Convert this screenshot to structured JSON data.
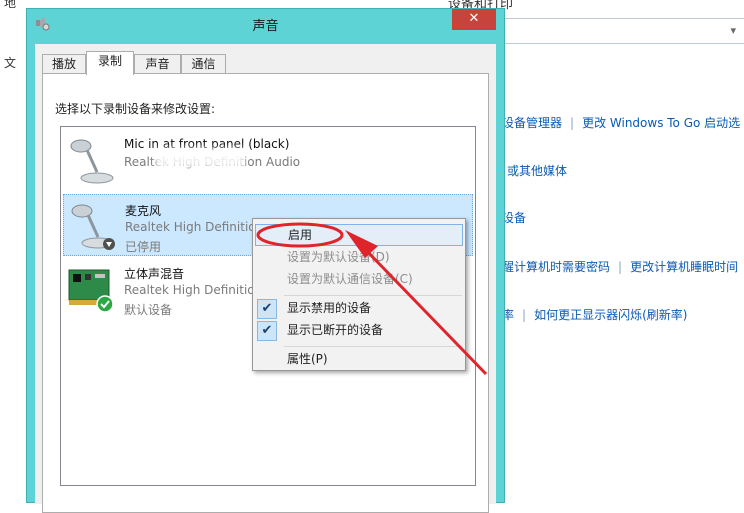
{
  "background": {
    "window_title": "设备和打印",
    "left_glyphs": [
      "地",
      "文"
    ],
    "links": [
      {
        "items": [
          "设备管理器",
          "更改 Windows To Go 启动选"
        ]
      },
      {
        "items": [
          "或其他媒体"
        ]
      },
      {
        "items": [
          "设备"
        ]
      },
      {
        "items": [
          "醒计算机时需要密码",
          "更改计算机睡眠时间"
        ]
      },
      {
        "items": [
          "率",
          "如何更正显示器闪烁(刷新率)"
        ]
      }
    ]
  },
  "dialog": {
    "title": "声音",
    "close_glyph": "✕",
    "tabs": [
      {
        "label": "播放"
      },
      {
        "label": "录制"
      },
      {
        "label": "声音"
      },
      {
        "label": "通信"
      }
    ],
    "instruction": "选择以下录制设备来修改设置:",
    "devices": [
      {
        "name": "Mic in at front panel (black)",
        "driver": "Realtek High Definition Audio",
        "status": ""
      },
      {
        "name": "麦克风",
        "driver": "Realtek High Definition Audio",
        "status": "已停用"
      },
      {
        "name": "立体声混音",
        "driver": "Realtek High Definition",
        "status": "默认设备"
      }
    ]
  },
  "context_menu": {
    "items": [
      {
        "label": "启用",
        "state": "highlighted"
      },
      {
        "label": "设置为默认设备(D)",
        "state": "disabled"
      },
      {
        "label": "设置为默认通信设备(C)",
        "state": "disabled"
      },
      {
        "label": "显示禁用的设备",
        "state": "checked"
      },
      {
        "label": "显示已断开的设备",
        "state": "checked"
      },
      {
        "label": "属性(P)",
        "state": "normal"
      }
    ],
    "check_glyph": "✔"
  },
  "colors": {
    "title_bar": "#5ed3d5",
    "close_button": "#c7443c",
    "selection": "#cce8ff",
    "link": "#0a5ab4",
    "annotation": "#e0242b"
  }
}
